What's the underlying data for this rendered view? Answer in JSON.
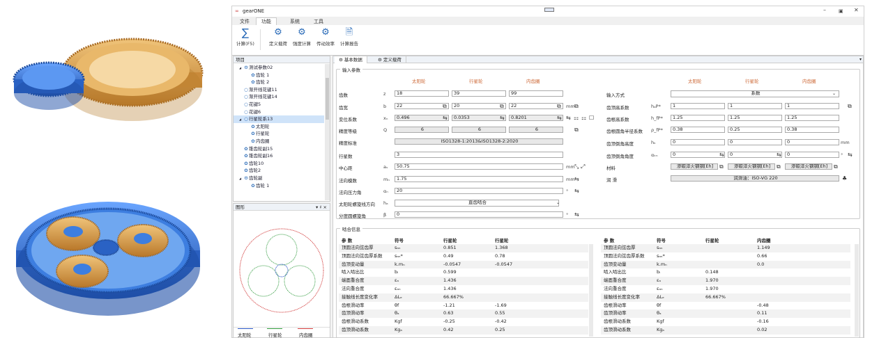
{
  "window": {
    "title": "gearONE",
    "menus": [
      "文件",
      "功能",
      "系统",
      "工具"
    ],
    "active_menu": 1
  },
  "ribbon": {
    "buttons": [
      {
        "label": "计算(F5)",
        "icon": "sum-icon"
      },
      {
        "label": "定义载荷",
        "icon": "gear-settings-icon"
      },
      {
        "label": "强度计算",
        "icon": "gear-settings-icon"
      },
      {
        "label": "传动效率",
        "icon": "gears-icon"
      },
      {
        "label": "计算报告",
        "icon": "report-icon"
      }
    ]
  },
  "tree": {
    "header": "项目",
    "items": [
      {
        "label": "测试参数02",
        "level": 0,
        "icon": "gearset-icon",
        "expand": "▲"
      },
      {
        "label": "齿轮 1",
        "level": 1,
        "icon": "gear-icon"
      },
      {
        "label": "齿轮 2",
        "level": 1,
        "icon": "gear-icon"
      },
      {
        "label": "渐开线花键11",
        "level": 0,
        "icon": "ring-icon"
      },
      {
        "label": "渐开线花键14",
        "level": 0,
        "icon": "ring-icon"
      },
      {
        "label": "花键5",
        "level": 0,
        "icon": "ring-icon"
      },
      {
        "label": "花键6",
        "level": 0,
        "icon": "ring-icon"
      },
      {
        "label": "行星轮系13",
        "level": 0,
        "icon": "ring-icon",
        "expand": "▲",
        "selected": true
      },
      {
        "label": "太阳轮",
        "level": 1,
        "icon": "gear-icon"
      },
      {
        "label": "行星轮",
        "level": 1,
        "icon": "gear-icon"
      },
      {
        "label": "内齿圈",
        "level": 1,
        "icon": "gear-icon"
      },
      {
        "label": "锥齿轮副15",
        "level": 0,
        "icon": "gear-icon"
      },
      {
        "label": "锥齿轮副16",
        "level": 0,
        "icon": "gear-icon"
      },
      {
        "label": "齿轮10",
        "level": 0,
        "icon": "gear-icon"
      },
      {
        "label": "齿轮2",
        "level": 0,
        "icon": "gear-icon"
      },
      {
        "label": "齿轮副",
        "level": 0,
        "icon": "gearset-icon",
        "expand": "▲"
      },
      {
        "label": "齿轮 1",
        "level": 1,
        "icon": "gear-icon"
      }
    ]
  },
  "graph": {
    "header": "图形",
    "pin": "▾ ♯ ×",
    "legend": [
      {
        "label": "太阳轮",
        "color": "#2a56c6"
      },
      {
        "label": "行星轮",
        "color": "#2f9a3c"
      },
      {
        "label": "内齿圈",
        "color": "#d23b3b"
      }
    ]
  },
  "tabs": [
    "基本数据",
    "定义载荷"
  ],
  "input": {
    "title": "输入参数",
    "col_headers": [
      "太阳轮",
      "行星轮",
      "内齿圈"
    ],
    "rows": [
      {
        "label": "齿数",
        "sym": "z",
        "unit": "",
        "vals": [
          "18",
          "39",
          "99"
        ]
      },
      {
        "label": "齿宽",
        "sym": "b",
        "unit": "mm",
        "vals": [
          "22",
          "20",
          "22"
        ]
      },
      {
        "label": "变位系数",
        "sym": "xₙ",
        "unit": "",
        "vals": [
          "0.496",
          "0.0353",
          "0.8201"
        ]
      },
      {
        "label": "精度等级",
        "sym": "Q",
        "unit": "",
        "vals": [
          "6",
          "6",
          "6"
        ]
      }
    ],
    "accuracy_std_label": "精度标准",
    "accuracy_std": "ISO1328-1:2013&ISO1328-2:2020",
    "single": [
      {
        "label": "行星数",
        "sym": "",
        "unit": "",
        "val": "3"
      },
      {
        "label": "中心距",
        "sym": "aᵥ",
        "unit": "mm",
        "val": "50.75"
      },
      {
        "label": "法向模数",
        "sym": "mₙ",
        "unit": "mm",
        "val": "1.75"
      },
      {
        "label": "法向压力角",
        "sym": "αₙ",
        "unit": "°",
        "val": "20"
      },
      {
        "label": "太阳轮螺旋线方向",
        "sym": "hₐ",
        "unit": "",
        "val": "直齿啮合"
      },
      {
        "label": "分度圆螺旋角",
        "sym": "β",
        "unit": "°",
        "val": "0"
      }
    ],
    "right_headers": [
      "太阳轮",
      "行星轮",
      "内齿圈"
    ],
    "input_mode_label": "输入方式",
    "input_mode": "系数",
    "right_rows": [
      {
        "label": "齿顶高系数",
        "sym": "hₐP*",
        "unit": "",
        "vals": [
          "1",
          "1",
          "1"
        ]
      },
      {
        "label": "齿根高系数",
        "sym": "h_fP*",
        "unit": "",
        "vals": [
          "1.25",
          "1.25",
          "1.25"
        ]
      },
      {
        "label": "齿根圆角半径系数",
        "sym": "ρ_fP*",
        "unit": "",
        "vals": [
          "0.38",
          "0.25",
          "0.38"
        ]
      },
      {
        "label": "齿顶倒角高度",
        "sym": "hₖ",
        "unit": "mm",
        "vals": [
          "0",
          "0",
          "0"
        ]
      },
      {
        "label": "齿顶倒角角度",
        "sym": "αₖₙ",
        "unit": "°",
        "vals": [
          "0",
          "0",
          "0"
        ]
      },
      {
        "label": "材料",
        "sym": "",
        "unit": "",
        "vals": [
          "渗碳淬火钢钢[Eh]",
          "渗碳淬火钢钢[Eh]",
          "渗碳淬火钢钢[Eh]"
        ]
      }
    ],
    "lube_label": "润 滑",
    "lube": "润滑油：ISO-VG 220"
  },
  "mesh": {
    "title": "啮合信息",
    "left_headers": [
      "参 数",
      "符号",
      "行星轮",
      "行星轮"
    ],
    "left_rows": [
      [
        "顶圆法向弦齿厚",
        "sₐₙ",
        "0.851",
        "1.368"
      ],
      [
        "顶圆法向弦齿厚系数",
        "sₐₙ*",
        "0.49",
        "0.78"
      ],
      [
        "齿顶变动量",
        "k.mₙ",
        "-0.0547",
        "-0.0547"
      ],
      [
        "啮入啮出比",
        "bᵢ",
        "0.599",
        ""
      ],
      [
        "端面重合度",
        "εₐ",
        "1.436",
        ""
      ],
      [
        "法向重合度",
        "εₐₙ",
        "1.436",
        ""
      ],
      [
        "接触线长度变化率",
        "ΔLₑ",
        "66.667%",
        ""
      ],
      [
        "齿根滑动率",
        "θf",
        "-1.21",
        "-1.69"
      ],
      [
        "齿顶滑动率",
        "θₐ",
        "0.63",
        "0.55"
      ],
      [
        "齿根滑动系数",
        "Kgf",
        "-0.25",
        "-0.42"
      ],
      [
        "齿顶滑动系数",
        "Kgₐ",
        "0.42",
        "0.25"
      ]
    ],
    "right_headers": [
      "参 数",
      "符号",
      "行星轮",
      "内齿圈"
    ],
    "right_rows": [
      [
        "顶圆法向弦齿厚",
        "sₐₙ",
        "",
        "1.149"
      ],
      [
        "顶圆法向弦齿厚系数",
        "sₐₙ*",
        "",
        "0.66"
      ],
      [
        "齿顶变动量",
        "k.mₙ",
        "",
        "0.0"
      ],
      [
        "啮入啮出比",
        "bᵢ",
        "0.148",
        ""
      ],
      [
        "端面重合度",
        "εₐ",
        "1.970",
        ""
      ],
      [
        "法向重合度",
        "εₐₙ",
        "1.970",
        ""
      ],
      [
        "接触线长度变化率",
        "ΔLₑ",
        "66.667%",
        ""
      ],
      [
        "齿根滑动率",
        "θf",
        "",
        "-0.48"
      ],
      [
        "齿顶滑动率",
        "θₐ",
        "",
        "0.11"
      ],
      [
        "齿根滑动系数",
        "Kgf",
        "",
        "-0.16"
      ],
      [
        "齿顶滑动系数",
        "Kgₐ",
        "",
        "0.02"
      ]
    ]
  },
  "colors": {
    "sun": "#2f6fd0",
    "planet": "#d99a3f",
    "ring": "#2f6fd0",
    "accent": "#2a6bb8"
  }
}
